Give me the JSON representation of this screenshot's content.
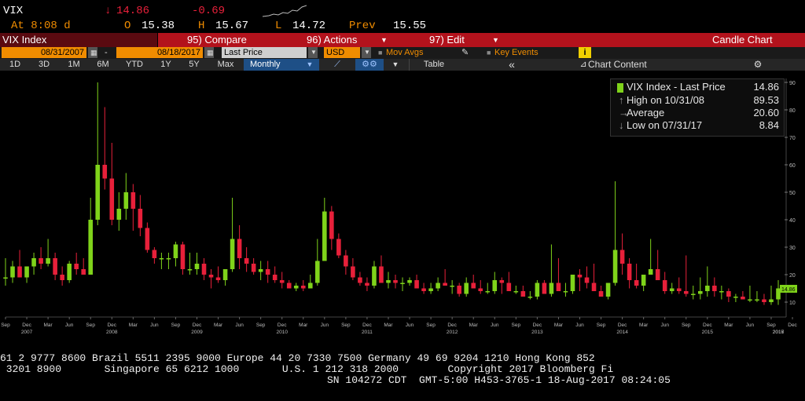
{
  "header": {
    "ticker": "VIX",
    "arrow": "↓",
    "last": "14.86",
    "change": "-0.69",
    "at_label": "At 8:08 d",
    "open_label": "O",
    "open": "15.38",
    "high_label": "H",
    "high": "15.67",
    "low_label": "L",
    "low": "14.72",
    "prev_label": "Prev",
    "prev": "15.55"
  },
  "menu": {
    "title": "VIX Index",
    "compare": "95) Compare",
    "actions": "96) Actions",
    "edit": "97) Edit",
    "chart_type": "Candle Chart"
  },
  "fields": {
    "start_date": "08/31/2007",
    "dash": "-",
    "end_date": "08/18/2017",
    "price_field": "Last Price",
    "currency": "USD",
    "mov_avgs": "Mov Avgs",
    "key_events": "Key Events",
    "info": "i"
  },
  "tabs": {
    "ranges": [
      "1D",
      "3D",
      "1M",
      "6M",
      "YTD",
      "1Y",
      "5Y",
      "Max"
    ],
    "period": "Monthly",
    "table": "Table",
    "collapse": "«",
    "chart_content": "Chart Content"
  },
  "legend": {
    "series": "VIX Index - Last Price",
    "series_value": "14.86",
    "high_label": "High on 10/31/08",
    "high_value": "89.53",
    "avg_label": "Average",
    "avg_value": "20.60",
    "low_label": "Low on 07/31/17",
    "low_value": "8.84"
  },
  "last_tag": "14.86",
  "footer": {
    "line1": "61 2 9777 8600 Brazil 5511 2395 9000 Europe 44 20 7330 7500 Germany 49 69 9204 1210 Hong Kong 852",
    "line2": " 3201 8900       Singapore 65 6212 1000       U.S. 1 212 318 2000        Copyright 2017 Bloomberg Fi",
    "line3": "SN 104272 CDT  GMT-5:00 H453-3765-1 18-Aug-2017 08:24:05"
  },
  "colors": {
    "up": "#7fd31a",
    "down": "#e8203a",
    "menu_bar": "#b3121c",
    "date_field": "#f08c00"
  },
  "chart_data": {
    "type": "candlestick",
    "ylim": [
      0,
      95
    ],
    "y_ticks": [
      10,
      20,
      30,
      40,
      50,
      60,
      70,
      80,
      90
    ],
    "x_month_labels": [
      "Sep",
      "Dec",
      "Mar",
      "Jun",
      "Sep",
      "Dec",
      "Mar",
      "Jun",
      "Sep",
      "Dec",
      "Mar",
      "Jun",
      "Sep",
      "Dec",
      "Mar",
      "Jun",
      "Sep",
      "Dec",
      "Mar",
      "Jun",
      "Sep",
      "Dec",
      "Mar",
      "Jun",
      "Sep",
      "Dec",
      "Mar",
      "Jun",
      "Sep",
      "Dec",
      "Mar",
      "Jun",
      "Sep",
      "Dec",
      "Mar",
      "Jun",
      "Sep",
      "Dec",
      "Mar",
      "Jun",
      "Sep"
    ],
    "x_year_labels": [
      "2007",
      "2008",
      "2009",
      "2010",
      "2011",
      "2012",
      "2013",
      "2014",
      "2015",
      "2016",
      "2017"
    ],
    "candles": [
      [
        19,
        26,
        16,
        19
      ],
      [
        19,
        25,
        17,
        23
      ],
      [
        23,
        29,
        20,
        19
      ],
      [
        19,
        23,
        17,
        23
      ],
      [
        23,
        28,
        20,
        26
      ],
      [
        26,
        30,
        22,
        24
      ],
      [
        24,
        33,
        23,
        26
      ],
      [
        26,
        28,
        18,
        20
      ],
      [
        20,
        23,
        16,
        18
      ],
      [
        18,
        25,
        17,
        24
      ],
      [
        24,
        28,
        20,
        22
      ],
      [
        22,
        26,
        20,
        20
      ],
      [
        20,
        48,
        20,
        40
      ],
      [
        40,
        90,
        38,
        60
      ],
      [
        60,
        81,
        51,
        55
      ],
      [
        55,
        68,
        38,
        40
      ],
      [
        40,
        50,
        36,
        44
      ],
      [
        44,
        57,
        40,
        50
      ],
      [
        50,
        53,
        36,
        44
      ],
      [
        44,
        49,
        34,
        37
      ],
      [
        37,
        39,
        28,
        29
      ],
      [
        29,
        30,
        24,
        26
      ],
      [
        26,
        28,
        22,
        26
      ],
      [
        26,
        28,
        22,
        26
      ],
      [
        26,
        32,
        23,
        31
      ],
      [
        31,
        32,
        20,
        22
      ],
      [
        22,
        28,
        20,
        22
      ],
      [
        22,
        28,
        20,
        24
      ],
      [
        24,
        26,
        18,
        20
      ],
      [
        20,
        22,
        15,
        19
      ],
      [
        19,
        23,
        17,
        18
      ],
      [
        18,
        22,
        16,
        22
      ],
      [
        22,
        48,
        21,
        33
      ],
      [
        33,
        38,
        22,
        26
      ],
      [
        26,
        30,
        21,
        24
      ],
      [
        24,
        26,
        20,
        21
      ],
      [
        21,
        25,
        18,
        22
      ],
      [
        22,
        25,
        17,
        20
      ],
      [
        20,
        23,
        17,
        18
      ],
      [
        18,
        21,
        15,
        17
      ],
      [
        17,
        18,
        15,
        15
      ],
      [
        15,
        17,
        14,
        16
      ],
      [
        16,
        18,
        14,
        15
      ],
      [
        15,
        20,
        15,
        17
      ],
      [
        17,
        33,
        16,
        25
      ],
      [
        25,
        48,
        25,
        43
      ],
      [
        43,
        45,
        29,
        33
      ],
      [
        33,
        35,
        26,
        27
      ],
      [
        27,
        29,
        20,
        23
      ],
      [
        23,
        26,
        18,
        19
      ],
      [
        19,
        21,
        16,
        17
      ],
      [
        17,
        19,
        14,
        16
      ],
      [
        16,
        25,
        15,
        23
      ],
      [
        23,
        27,
        17,
        17
      ],
      [
        17,
        21,
        15,
        18
      ],
      [
        18,
        20,
        15,
        17
      ],
      [
        17,
        19,
        14,
        17
      ],
      [
        17,
        19,
        16,
        18
      ],
      [
        18,
        20,
        15,
        15
      ],
      [
        15,
        17,
        13,
        14
      ],
      [
        14,
        17,
        13,
        15
      ],
      [
        15,
        19,
        14,
        17
      ],
      [
        17,
        22,
        16,
        16
      ],
      [
        16,
        18,
        13,
        16
      ],
      [
        16,
        17,
        12,
        13
      ],
      [
        13,
        19,
        12,
        17
      ],
      [
        17,
        20,
        15,
        15
      ],
      [
        15,
        18,
        13,
        14
      ],
      [
        14,
        17,
        13,
        14
      ],
      [
        14,
        21,
        13,
        18
      ],
      [
        18,
        19,
        13,
        17
      ],
      [
        17,
        21,
        14,
        14
      ],
      [
        14,
        16,
        13,
        14
      ],
      [
        14,
        16,
        12,
        12
      ],
      [
        12,
        14,
        11,
        12
      ],
      [
        12,
        18,
        11,
        17
      ],
      [
        17,
        18,
        13,
        13
      ],
      [
        13,
        31,
        12,
        17
      ],
      [
        17,
        26,
        14,
        14
      ],
      [
        14,
        17,
        12,
        14
      ],
      [
        14,
        17,
        13,
        20
      ],
      [
        20,
        22,
        14,
        19
      ],
      [
        19,
        23,
        15,
        17
      ],
      [
        17,
        24,
        16,
        14
      ],
      [
        14,
        16,
        12,
        12
      ],
      [
        12,
        15,
        11,
        17
      ],
      [
        17,
        54,
        16,
        29
      ],
      [
        29,
        35,
        20,
        24
      ],
      [
        24,
        26,
        15,
        18
      ],
      [
        18,
        24,
        15,
        16
      ],
      [
        16,
        20,
        14,
        20
      ],
      [
        20,
        33,
        20,
        22
      ],
      [
        22,
        29,
        18,
        18
      ],
      [
        18,
        21,
        13,
        14
      ],
      [
        14,
        17,
        13,
        15
      ],
      [
        15,
        19,
        13,
        14
      ],
      [
        14,
        27,
        12,
        13
      ],
      [
        13,
        16,
        11,
        13
      ],
      [
        13,
        19,
        11,
        14
      ],
      [
        14,
        23,
        12,
        16
      ],
      [
        16,
        19,
        12,
        14
      ],
      [
        14,
        16,
        11,
        14
      ],
      [
        14,
        15,
        10,
        12
      ],
      [
        12,
        13,
        10,
        12
      ],
      [
        12,
        14,
        11,
        11
      ],
      [
        11,
        16,
        10,
        11
      ],
      [
        11,
        14,
        10,
        11
      ],
      [
        11,
        13,
        9,
        10
      ],
      [
        10,
        16,
        9,
        11
      ],
      [
        11,
        18,
        9,
        15
      ]
    ]
  }
}
